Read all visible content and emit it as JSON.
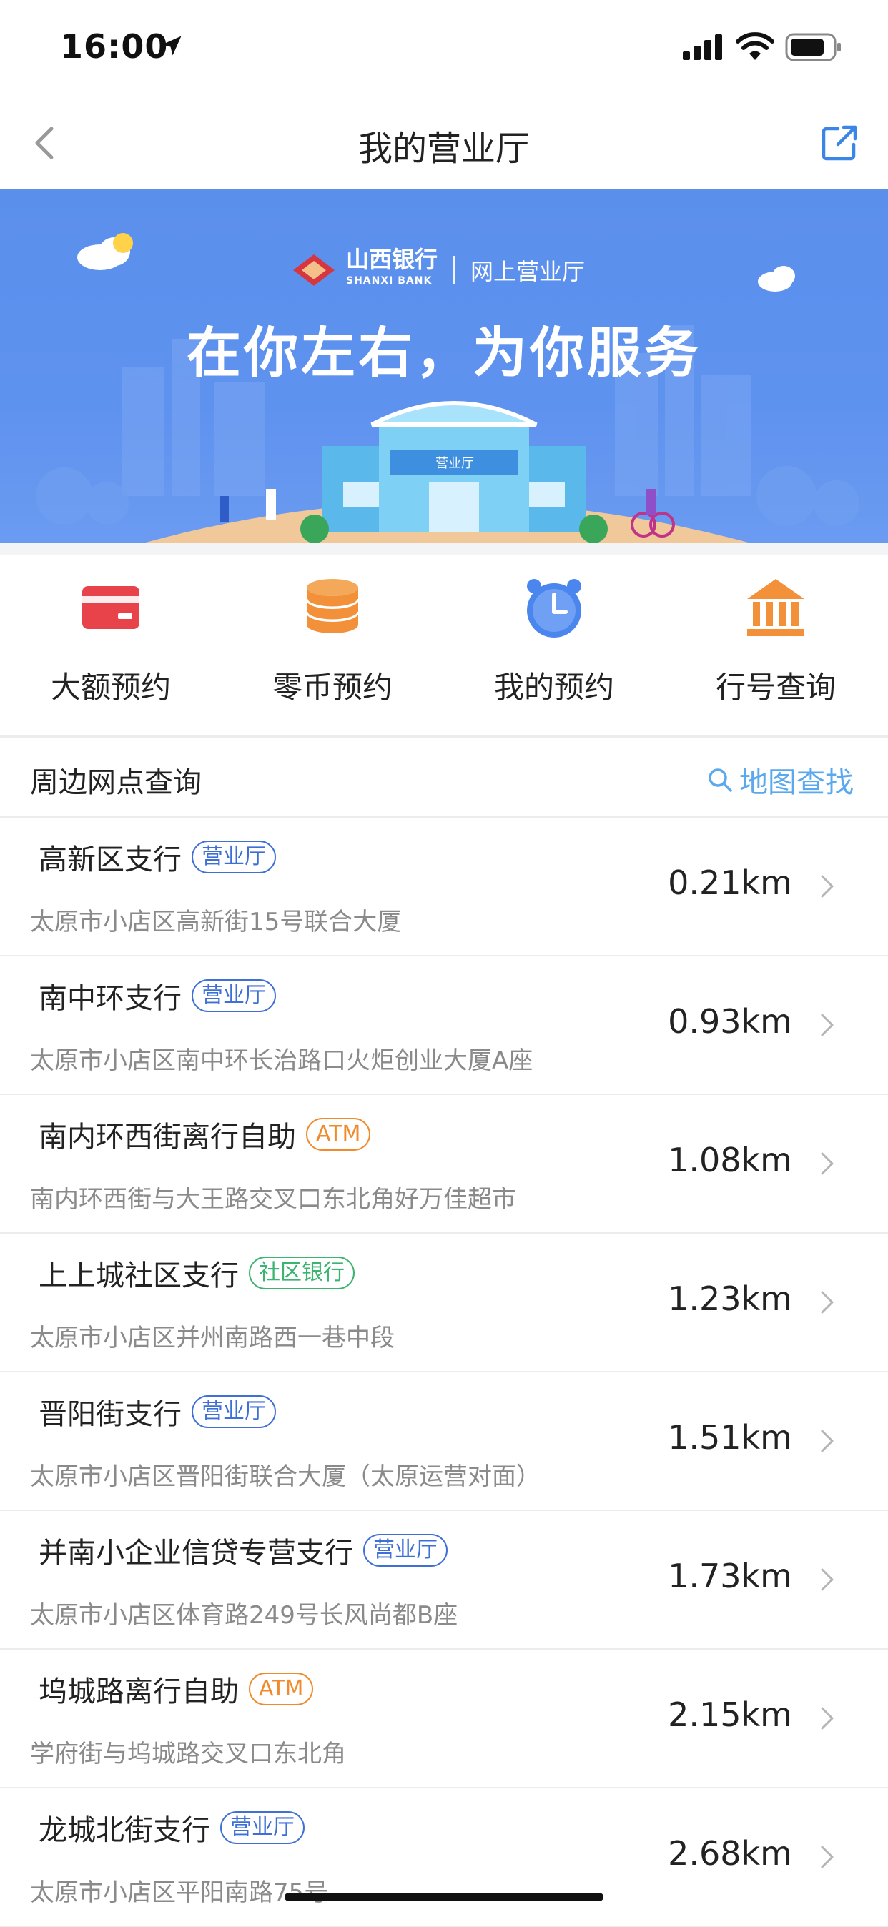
{
  "status": {
    "time": "16:00"
  },
  "nav": {
    "title": "我的营业厅"
  },
  "banner": {
    "bank_name_cn": "山西银行",
    "bank_name_en": "SHANXI BANK",
    "channel": "网上营业厅",
    "slogan": "在你左右，为你服务",
    "building_sign": "营业厅"
  },
  "quick_actions": [
    {
      "label": "大额预约",
      "icon": "card-icon",
      "color": "#e8424a"
    },
    {
      "label": "零币预约",
      "icon": "coin-stack-icon",
      "color": "#f2913a"
    },
    {
      "label": "我的预约",
      "icon": "alarm-clock-icon",
      "color": "#4a86ee"
    },
    {
      "label": "行号查询",
      "icon": "bank-icon",
      "color": "#f2913a"
    }
  ],
  "nearby": {
    "title": "周边网点查询",
    "map_search_label": "地图查找",
    "items": [
      {
        "name": "高新区支行",
        "badge": "营业厅",
        "badge_type": "blue",
        "address": "太原市小店区高新街15号联合大厦",
        "distance": "0.21km"
      },
      {
        "name": "南中环支行",
        "badge": "营业厅",
        "badge_type": "blue",
        "address": "太原市小店区南中环长治路口火炬创业大厦A座",
        "distance": "0.93km"
      },
      {
        "name": "南内环西街离行自助",
        "badge": "ATM",
        "badge_type": "orange",
        "address": "南内环西街与大王路交叉口东北角好万佳超市",
        "distance": "1.08km"
      },
      {
        "name": "上上城社区支行",
        "badge": "社区银行",
        "badge_type": "green",
        "address": "太原市小店区并州南路西一巷中段",
        "distance": "1.23km"
      },
      {
        "name": "晋阳街支行",
        "badge": "营业厅",
        "badge_type": "blue",
        "address": "太原市小店区晋阳街联合大厦（太原运营对面）",
        "distance": "1.51km"
      },
      {
        "name": "并南小企业信贷专营支行",
        "badge": "营业厅",
        "badge_type": "blue",
        "address": "太原市小店区体育路249号长风尚都B座",
        "distance": "1.73km"
      },
      {
        "name": "坞城路离行自助",
        "badge": "ATM",
        "badge_type": "orange",
        "address": "学府街与坞城路交叉口东北角",
        "distance": "2.15km"
      },
      {
        "name": "龙城北街支行",
        "badge": "营业厅",
        "badge_type": "blue",
        "address": "太原市小店区平阳南路75号",
        "distance": "2.68km"
      }
    ]
  }
}
